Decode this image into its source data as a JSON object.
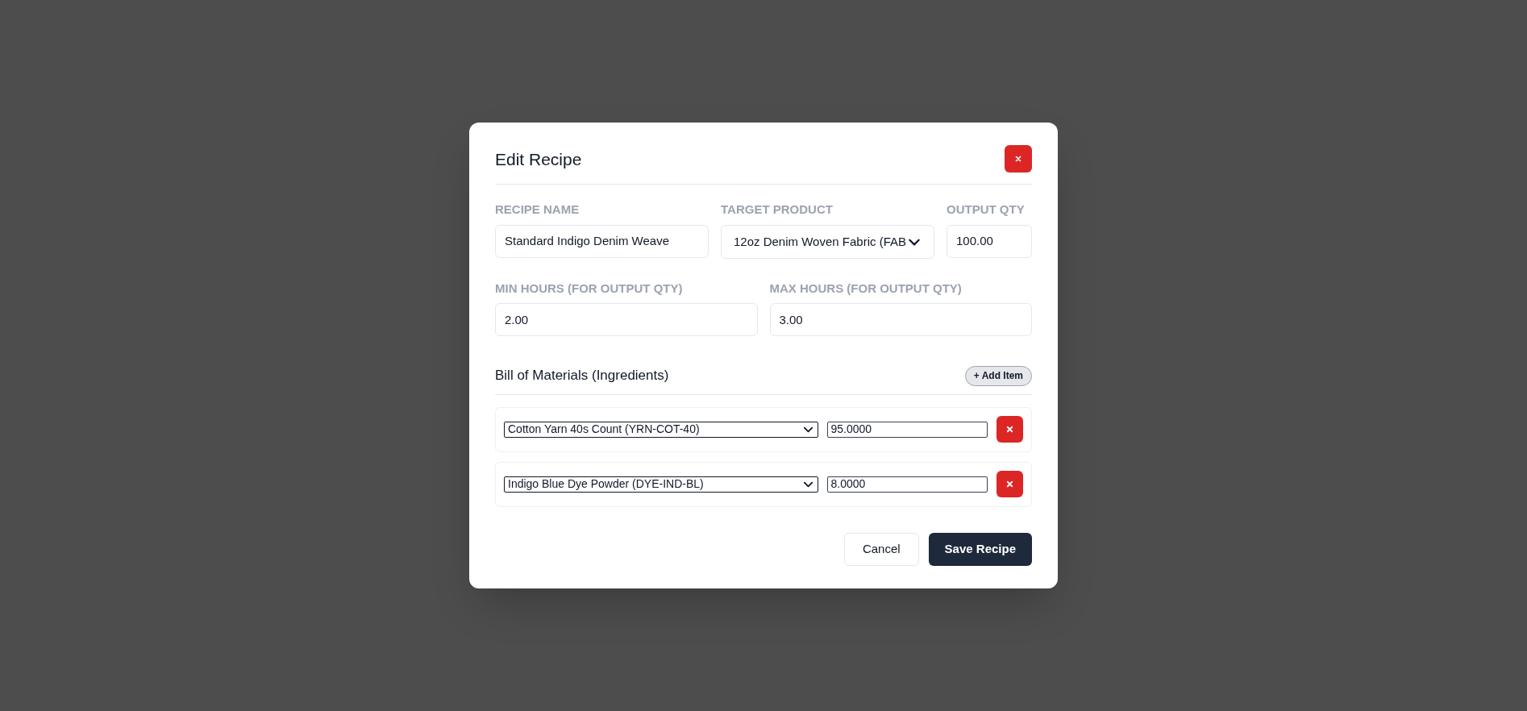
{
  "dialog": {
    "title": "Edit Recipe",
    "fields": [
      {
        "label": "RECIPE NAME",
        "kind": "text",
        "value": "Standard Indigo Denim Weave"
      },
      {
        "label": "TARGET PRODUCT",
        "kind": "select",
        "value": "12oz Denim Woven Fabric (FAB"
      },
      {
        "label": "OUTPUT QTY",
        "kind": "text",
        "value": "100.00"
      },
      {
        "label": "MIN HOURS (FOR OUTPUT QTY)",
        "kind": "text",
        "value": "2.00"
      },
      {
        "label": "MAX HOURS (FOR OUTPUT QTY)",
        "kind": "text",
        "value": "3.00"
      }
    ],
    "bom": {
      "title": "Bill of Materials (Ingredients)",
      "add_button": "+ Add Item",
      "items": [
        {
          "material": "Cotton Yarn 40s Count (YRN-COT-40)",
          "quantity": "95.0000"
        },
        {
          "material": "Indigo Blue Dye Powder (DYE-IND-BL)",
          "quantity": "8.0000"
        }
      ]
    },
    "buttons": {
      "cancel": "Cancel",
      "save": "Save Recipe"
    }
  }
}
